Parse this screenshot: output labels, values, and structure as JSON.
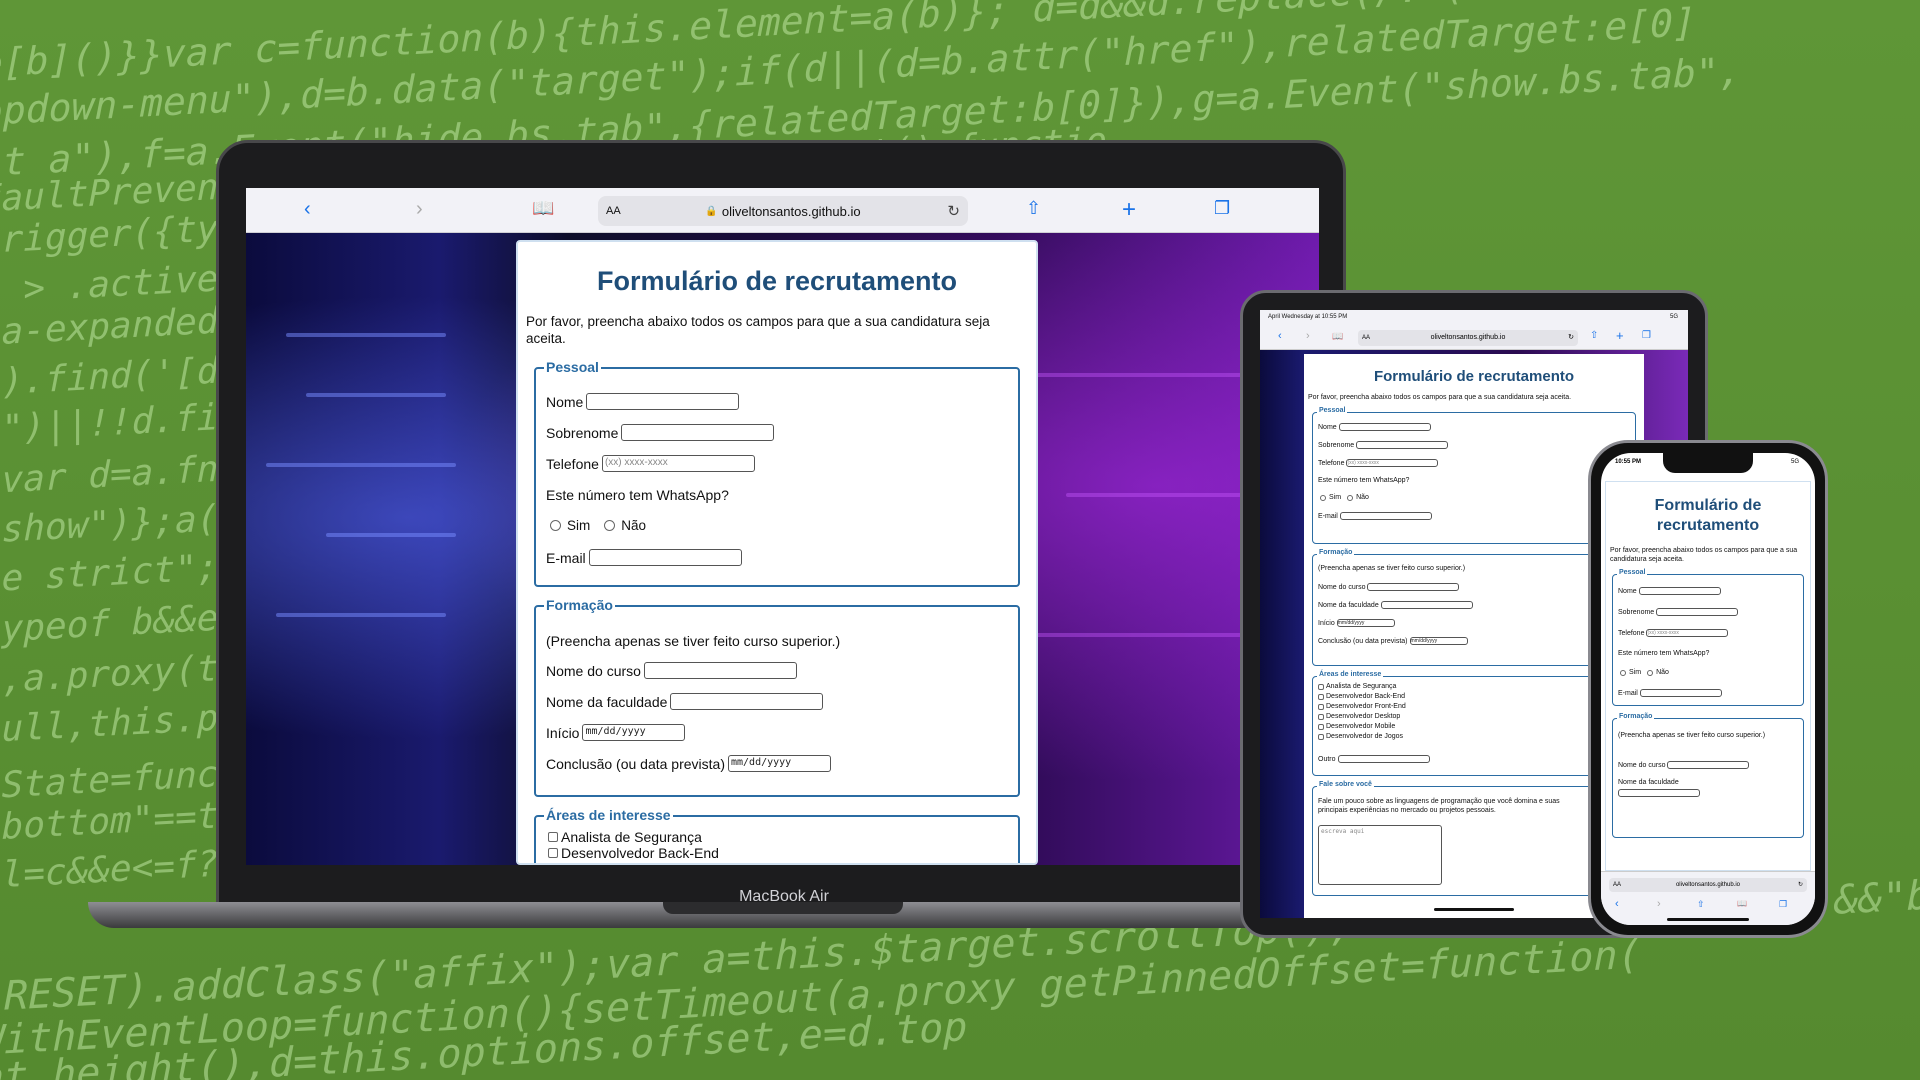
{
  "background_code": [
    "e[b]()}}var c=function(b){this.element=a(b)}; d=d&&d.replace(/.*(?=#[^\\s]*$)/,",
    "opdown-menu\"),d=b.data(\"target\");if(d||(d=b.attr(\"href\"),relatedTarget:e[0]",
    "st a\"),f=a.Event(\"hide.bs.tab\",{relatedTarget:b[0]}),g=a.Event(\"show.bs.tab\",",
    "faultPrevented(){ this.activate(h,h.parent(),functio",
    "trigger({type:\" =function(b,d,e){func",
    "u > .active\").r (\"aria-expanded\",!1),",
    "ia-expanded\",! .dropdow",
    "().find('[data- ),h=e&&",
    "e\")||!!d.find( nd",
    ";var d=a.fn.tal fn.t",
    "\"show\")};a(docu ata",
    "se strict\";fun ob",
    "typeof b&&e[b] t=a",
    "\",a.proxy(this onWi",
    "null,this.pinn top",
    "tState=function ,g=this.$targ",
    "\"bottom\"==this",
    "ll=c&&e<=f?",
    ".RESET).addClass(\"affix\");var a=this.$target.scrollTop(),\"bottom\":!(e+g<=a-d)&&\"bottom\"",
    "WithEventLoop=function(){setTimeout(a.proxy getPinnedOffset=function(",
    "nt.height(),d=this.options.offset,e=d.top"
  ],
  "devices": {
    "macbook_label": "MacBook Air",
    "url": "oliveltonsantos.github.io",
    "aa": "AA",
    "ipad_status": "April Wednesday at 10:55 PM",
    "ipad_status_right": "5G",
    "iphone_time": "10:55 PM",
    "iphone_status_right": "5G"
  },
  "form": {
    "title": "Formulário de recrutamento",
    "intro": "Por favor, preencha abaixo todos os campos para que a sua candidatura seja aceita.",
    "pessoal": {
      "legend": "Pessoal",
      "nome": "Nome",
      "sobrenome": "Sobrenome",
      "telefone": "Telefone",
      "telefone_placeholder": "(xx) xxxx-xxxx",
      "whatsapp_q": "Este número tem WhatsApp?",
      "sim": "Sim",
      "nao": "Não",
      "email": "E-mail"
    },
    "formacao": {
      "legend": "Formação",
      "note": "(Preencha apenas se tiver feito curso superior.)",
      "curso": "Nome do curso",
      "faculdade": "Nome da faculdade",
      "inicio": "Início",
      "conclusao": "Conclusão (ou data prevista)",
      "date_placeholder": "mm/dd/yyyy"
    },
    "areas": {
      "legend": "Áreas de interesse",
      "items": [
        "Analista de Segurança",
        "Desenvolvedor Back-End",
        "Desenvolvedor Front-End",
        "Desenvolvedor Desktop",
        "Desenvolvedor Mobile",
        "Desenvolvedor de Jogos"
      ],
      "outro": "Outro"
    },
    "sobre": {
      "legend": "Fale sobre você",
      "text": "Fale um pouco sobre as linguagens de programação que você domina e suas principais experiências no mercado ou projetos pessoais.",
      "placeholder": "escreva aqui"
    }
  }
}
